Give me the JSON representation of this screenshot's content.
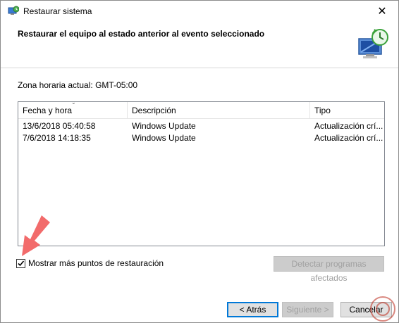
{
  "window": {
    "title": "Restaurar sistema",
    "close_glyph": "✕"
  },
  "header": {
    "title": "Restaurar el equipo al estado anterior al evento seleccionado",
    "icon": "system-restore-icon"
  },
  "timezone": {
    "label": "Zona horaria actual: GMT-05:00"
  },
  "table": {
    "columns": [
      "Fecha y hora",
      "Descripción",
      "Tipo"
    ],
    "rows": [
      {
        "date": "13/6/2018 05:40:58",
        "description": "Windows Update",
        "type": "Actualización crí..."
      },
      {
        "date": "7/6/2018 14:18:35",
        "description": "Windows Update",
        "type": "Actualización crí..."
      }
    ]
  },
  "show_more": {
    "label": "Mostrar más puntos de restauración",
    "checked": true
  },
  "buttons": {
    "detect": "Detectar programas afectados",
    "back": "< Atrás",
    "next": "Siguiente >",
    "cancel": "Cancelar"
  },
  "colors": {
    "accent": "#0078d7",
    "arrow": "#f26b6b",
    "disabled_text": "#a0a0a0"
  }
}
